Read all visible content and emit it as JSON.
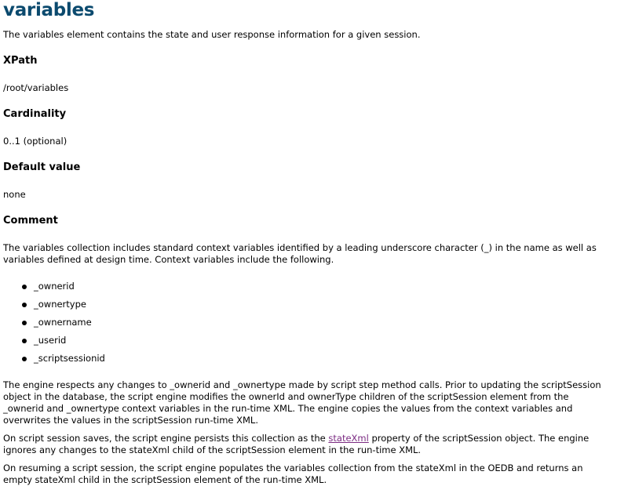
{
  "title": "variables",
  "intro": "The variables element contains the state and user response information for a given session.",
  "sections": {
    "xpath": {
      "heading": "XPath",
      "value": "/root/variables"
    },
    "cardinality": {
      "heading": "Cardinality",
      "value": "0..1 (optional)"
    },
    "default": {
      "heading": "Default value",
      "value": "none"
    },
    "comment": {
      "heading": "Comment"
    }
  },
  "comment_intro": "The variables collection includes standard context variables identified by a leading underscore character (_) in the name as well as variables defined at design time. Context variables include the following.",
  "context_variables": [
    "_ownerid",
    "_ownertype",
    "_ownername",
    "_userid",
    "_scriptsessionid"
  ],
  "para_engine": "The engine respects any changes to _ownerid and _ownertype made by script step method calls. Prior to updating the scriptSession object in the database, the script engine modifies the ownerId and ownerType children of the scriptSession element from the _ownerid and _ownertype context variables in the run-time XML. The engine copies the values from the context variables and overwrites the values in the scriptSession run-time XML.",
  "para_save": {
    "before": "On script session saves, the script engine persists this collection as the ",
    "link": "stateXml",
    "after": " property of the scriptSession object. The engine ignores any changes to the stateXml child of the scriptSession element in the run-time XML."
  },
  "para_resume": "On resuming a script session, the script engine populates the variables collection from the stateXml in the OEDB and returns an empty stateXml child in the scriptSession element of the run-time XML."
}
